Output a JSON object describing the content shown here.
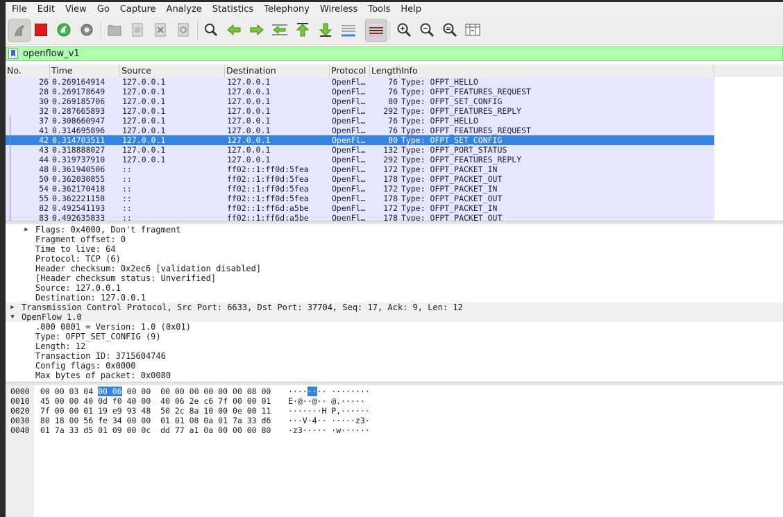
{
  "menu": [
    "File",
    "Edit",
    "View",
    "Go",
    "Capture",
    "Analyze",
    "Statistics",
    "Telephony",
    "Wireless",
    "Tools",
    "Help"
  ],
  "toolbar": {
    "icons": [
      "shark-fin-start-icon",
      "stop-capture-icon",
      "restart-capture-icon",
      "capture-options-icon",
      "open-file-icon",
      "save-file-icon",
      "close-file-icon",
      "reload-file-icon",
      "find-packet-icon",
      "go-back-icon",
      "go-forward-icon",
      "go-to-packet-icon",
      "go-first-packet-icon",
      "go-last-packet-icon",
      "autoscroll-icon",
      "colorize-icon",
      "zoom-in-icon",
      "zoom-out-icon",
      "zoom-normal-icon",
      "resize-columns-icon"
    ]
  },
  "filter": {
    "value": "openflow_v1"
  },
  "packet_list": {
    "columns": [
      "No.",
      "Time",
      "Source",
      "Destination",
      "Protocol",
      "Length",
      "Info"
    ],
    "rows": [
      {
        "no": "26",
        "time": "0.269164914",
        "src": "127.0.0.1",
        "dst": "127.0.0.1",
        "proto": "OpenFl…",
        "len": "76",
        "info": "Type: OFPT_HELLO"
      },
      {
        "no": "28",
        "time": "0.269178649",
        "src": "127.0.0.1",
        "dst": "127.0.0.1",
        "proto": "OpenFl…",
        "len": "76",
        "info": "Type: OFPT_FEATURES_REQUEST"
      },
      {
        "no": "30",
        "time": "0.269185706",
        "src": "127.0.0.1",
        "dst": "127.0.0.1",
        "proto": "OpenFl…",
        "len": "80",
        "info": "Type: OFPT_SET_CONFIG"
      },
      {
        "no": "32",
        "time": "0.287665893",
        "src": "127.0.0.1",
        "dst": "127.0.0.1",
        "proto": "OpenFl…",
        "len": "292",
        "info": "Type: OFPT_FEATURES_REPLY"
      },
      {
        "no": "37",
        "time": "0.308660947",
        "src": "127.0.0.1",
        "dst": "127.0.0.1",
        "proto": "OpenFl…",
        "len": "76",
        "info": "Type: OFPT_HELLO"
      },
      {
        "no": "41",
        "time": "0.314695896",
        "src": "127.0.0.1",
        "dst": "127.0.0.1",
        "proto": "OpenFl…",
        "len": "76",
        "info": "Type: OFPT_FEATURES_REQUEST"
      },
      {
        "no": "42",
        "time": "0.314703511",
        "src": "127.0.0.1",
        "dst": "127.0.0.1",
        "proto": "OpenFl…",
        "len": "80",
        "info": "Type: OFPT_SET_CONFIG",
        "selected": true
      },
      {
        "no": "43",
        "time": "0.318888027",
        "src": "127.0.0.1",
        "dst": "127.0.0.1",
        "proto": "OpenFl…",
        "len": "132",
        "info": "Type: OFPT_PORT_STATUS"
      },
      {
        "no": "44",
        "time": "0.319737910",
        "src": "127.0.0.1",
        "dst": "127.0.0.1",
        "proto": "OpenFl…",
        "len": "292",
        "info": "Type: OFPT_FEATURES_REPLY"
      },
      {
        "no": "48",
        "time": "0.361940506",
        "src": "::",
        "dst": "ff02::1:ff0d:5fea",
        "proto": "OpenFl…",
        "len": "172",
        "info": "Type: OFPT_PACKET_IN"
      },
      {
        "no": "50",
        "time": "0.362030855",
        "src": "::",
        "dst": "ff02::1:ff0d:5fea",
        "proto": "OpenFl…",
        "len": "178",
        "info": "Type: OFPT_PACKET_OUT"
      },
      {
        "no": "54",
        "time": "0.362170418",
        "src": "::",
        "dst": "ff02::1:ff0d:5fea",
        "proto": "OpenFl…",
        "len": "172",
        "info": "Type: OFPT_PACKET_IN"
      },
      {
        "no": "55",
        "time": "0.362221158",
        "src": "::",
        "dst": "ff02::1:ff0d:5fea",
        "proto": "OpenFl…",
        "len": "178",
        "info": "Type: OFPT_PACKET_OUT"
      },
      {
        "no": "82",
        "time": "0.492541193",
        "src": "::",
        "dst": "ff02::1:ff6d:a5be",
        "proto": "OpenFl…",
        "len": "172",
        "info": "Type: OFPT_PACKET_IN"
      },
      {
        "no": "83",
        "time": "0.492635833",
        "src": "::",
        "dst": "ff02::1:ff6d:a5be",
        "proto": "OpenFl…",
        "len": "178",
        "info": "Type: OFPT_PACKET_OUT"
      }
    ]
  },
  "details": [
    {
      "text": "Flags: 0x4000, Don't fragment",
      "indent": 2,
      "arrow": "collapsed"
    },
    {
      "text": "Fragment offset: 0",
      "indent": 2
    },
    {
      "text": "Time to live: 64",
      "indent": 2
    },
    {
      "text": "Protocol: TCP (6)",
      "indent": 2
    },
    {
      "text": "Header checksum: 0x2ec6 [validation disabled]",
      "indent": 2
    },
    {
      "text": "[Header checksum status: Unverified]",
      "indent": 2
    },
    {
      "text": "Source: 127.0.0.1",
      "indent": 2
    },
    {
      "text": "Destination: 127.0.0.1",
      "indent": 2
    },
    {
      "text": "Transmission Control Protocol, Src Port: 6633, Dst Port: 37704, Seq: 17, Ack: 9, Len: 12",
      "indent": 1,
      "arrow": "collapsed",
      "hl": true
    },
    {
      "text": "OpenFlow 1.0",
      "indent": 1,
      "arrow": "expanded",
      "hl": true
    },
    {
      "text": ".000 0001 = Version: 1.0 (0x01)",
      "indent": 2
    },
    {
      "text": "Type: OFPT_SET_CONFIG (9)",
      "indent": 2
    },
    {
      "text": "Length: 12",
      "indent": 2
    },
    {
      "text": "Transaction ID: 3715604746",
      "indent": 2
    },
    {
      "text": "Config flags: 0x0000",
      "indent": 2
    },
    {
      "text": "Max bytes of packet: 0x0080",
      "indent": 2
    }
  ],
  "bytes": [
    {
      "offset": "0000",
      "hex_pre": "00 00 03 04 ",
      "hex_hl": "00 06",
      "hex_post": " 00 00  00 00 00 00 00 00 08 00",
      "asc_pre": "····",
      "asc_hl": "··",
      "asc_post": "·· ········"
    },
    {
      "offset": "0010",
      "hex_pre": "45 00 00 40 0d f0 40 00  40 06 2e c6 7f 00 00 01",
      "hex_hl": "",
      "hex_post": "",
      "asc_pre": "E·@··@·· @.·····",
      "asc_hl": "",
      "asc_post": ""
    },
    {
      "offset": "0020",
      "hex_pre": "7f 00 00 01 19 e9 93 48  50 2c 8a 10 00 0e 00 11",
      "hex_hl": "",
      "hex_post": "",
      "asc_pre": "·······H P,······",
      "asc_hl": "",
      "asc_post": ""
    },
    {
      "offset": "0030",
      "hex_pre": "80 18 00 56 fe 34 00 00  01 01 08 0a 01 7a 33 d6",
      "hex_hl": "",
      "hex_post": "",
      "asc_pre": "···V·4·· ·····z3·",
      "asc_hl": "",
      "asc_post": ""
    },
    {
      "offset": "0040",
      "hex_pre": "01 7a 33 d5 01 09 00 0c  dd 77 a1 0a 00 00 00 80",
      "hex_hl": "",
      "hex_post": "",
      "asc_pre": "·z3····· ·w······",
      "asc_hl": "",
      "asc_post": ""
    }
  ]
}
